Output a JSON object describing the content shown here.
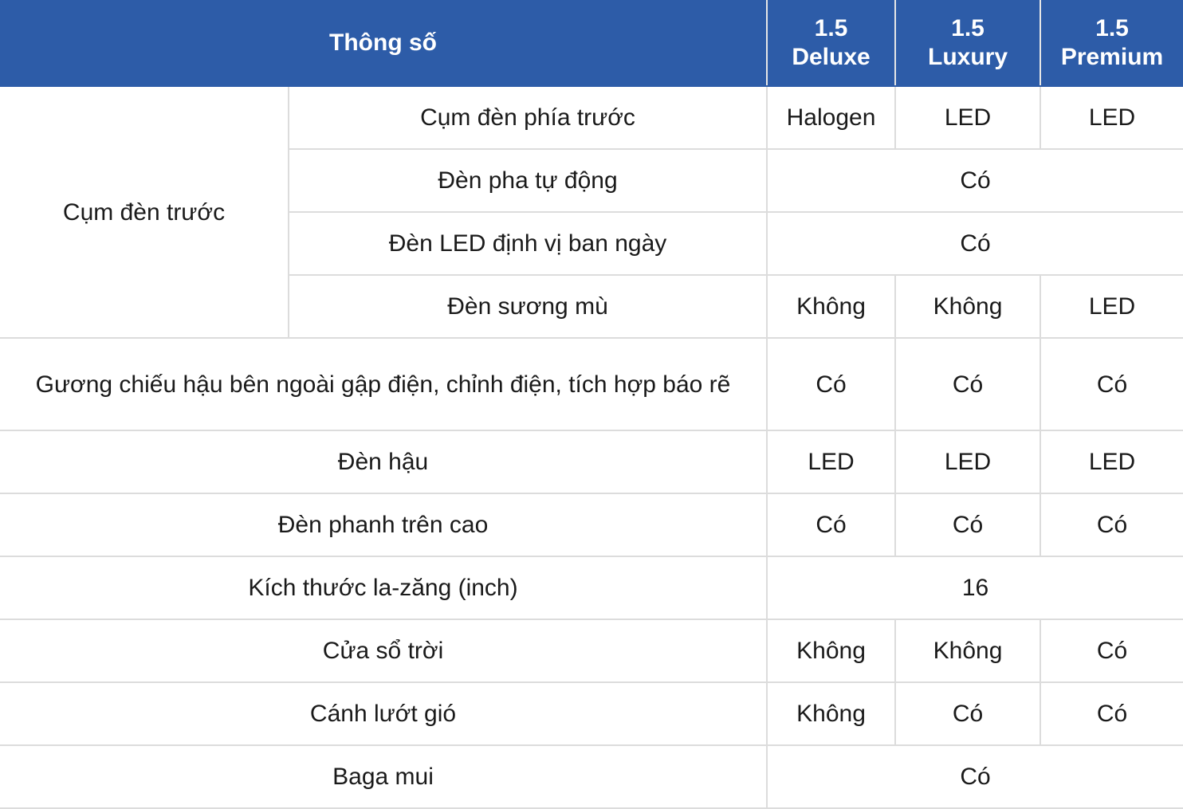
{
  "header": {
    "spec": "Thông số",
    "variants": [
      "1.5 Deluxe",
      "1.5 Luxury",
      "1.5 Premium"
    ],
    "variant_lines": [
      [
        "1.5",
        "Deluxe"
      ],
      [
        "1.5",
        "Luxury"
      ],
      [
        "1.5",
        "Premium"
      ]
    ]
  },
  "colors": {
    "header_bg": "#2d5ca8",
    "header_text": "#ffffff",
    "border": "#dcdcdc"
  },
  "group": {
    "label": "Cụm đèn trước",
    "rows": [
      {
        "label": "Cụm đèn phía trước",
        "values": [
          "Halogen",
          "LED",
          "LED"
        ]
      },
      {
        "label": "Đèn pha tự động",
        "merged": "Có"
      },
      {
        "label": "Đèn LED định vị ban ngày",
        "merged": "Có"
      },
      {
        "label": "Đèn sương mù",
        "values": [
          "Không",
          "Không",
          "LED"
        ]
      }
    ]
  },
  "rows": [
    {
      "label": "Gương chiếu hậu bên ngoài gập điện, chỉnh điện, tích hợp báo rẽ",
      "values": [
        "Có",
        "Có",
        "Có"
      ]
    },
    {
      "label": "Đèn hậu",
      "values": [
        "LED",
        "LED",
        "LED"
      ]
    },
    {
      "label": "Đèn phanh trên cao",
      "values": [
        "Có",
        "Có",
        "Có"
      ]
    },
    {
      "label": "Kích thước la-zăng (inch)",
      "merged": "16"
    },
    {
      "label": "Cửa sổ trời",
      "values": [
        "Không",
        "Không",
        "Có"
      ]
    },
    {
      "label": "Cánh lướt gió",
      "values": [
        "Không",
        "Có",
        "Có"
      ]
    },
    {
      "label": "Baga mui",
      "merged": "Có"
    }
  ]
}
